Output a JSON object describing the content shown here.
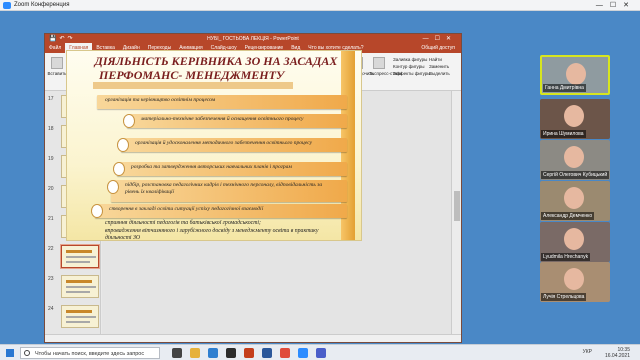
{
  "zoom": {
    "title": "Zoom Конференция"
  },
  "ppt": {
    "title": "НУБІ_ ГОСТЬОВА ЛЕКЦІЯ - PowerPoint",
    "tabs": [
      "Файл",
      "Главная",
      "Вставка",
      "Дизайн",
      "Переходы",
      "Анимация",
      "Слайд-шоу",
      "Рецензирование",
      "Вид",
      "Что вы хотите сделать?"
    ],
    "share": "Общий доступ",
    "ribbon": {
      "paste": "Вставить",
      "new_slide": "Создать слайд",
      "reset": "Сбросить",
      "section": "Раздел",
      "arrange": "Упорядочить",
      "quick_styles": "Экспресс-стили",
      "shape_fill": "Заливка фигуры",
      "shape_outline": "Контур фигуры",
      "shape_effects": "Эффекты фигуры",
      "find": "Найти",
      "replace": "Заменить",
      "select": "Выделить",
      "layout": "Макет"
    },
    "slide_numbers": [
      "17",
      "18",
      "19",
      "20",
      "21",
      "22",
      "23",
      "24"
    ],
    "selected_slide": "22"
  },
  "slide": {
    "title_line1": "ДІЯЛЬНІСТЬ  КЕРІВНИКА ЗО НА ЗАСАДАХ",
    "title_line2": "ПЕРФОМАНС- МЕНЕДЖМЕНТУ",
    "items": [
      "організація та керівництво освітнім  процесом",
      "матеріально-технічне забезпечення й оснащення освітнього  процесу",
      "організація й удосконалення методичного забезпечення освітнього процесу",
      "розробка та затвердження авторських навчальних планів і програм",
      "підбір, розстановка педагогічних кадрів і технічного персоналу, відповідальність за рівень їх кваліфікації",
      "створення в закладі освіти ситуації успіху педагогічної взаємодії",
      "сприяння діяльності педагогів та батьківської громадськості;",
      "впровадження вітчизняного і зарубіжного досвіду з менеджменту освіти в практику діяльності ЗО"
    ]
  },
  "participants": [
    {
      "name": "Ганна Дмитрівна"
    },
    {
      "name": "Ирина Шумилова"
    },
    {
      "name": "Сергій Олегович Кубицький"
    },
    {
      "name": "Александр Демченко"
    },
    {
      "name": "Lyudmila Hrechanyk"
    },
    {
      "name": "Лучія Стрельцова"
    }
  ],
  "taskbar": {
    "search_placeholder": "Чтобы начать поиск, введите здесь запрос",
    "time": "10:35",
    "date": "16.04.2021",
    "lang": "УКР"
  },
  "colors": {
    "ppt_accent": "#b7472a",
    "slide_title": "#7a1e1e",
    "bar": "#f0a94a"
  }
}
